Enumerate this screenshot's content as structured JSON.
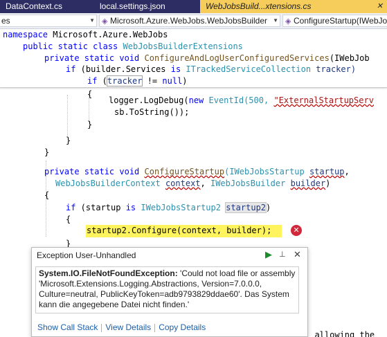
{
  "tabs": [
    {
      "label": "DataContext.cs",
      "close": ""
    },
    {
      "label": "local.settings.json",
      "close": ""
    },
    {
      "label": "WebJobsBuild...xtensions.cs",
      "close": "✕"
    }
  ],
  "navbar": {
    "project": "es",
    "type": "Microsoft.Azure.WebJobs.WebJobsBuilder",
    "member": "ConfigureStartup(IWebJo"
  },
  "code": {
    "l1_kw": "namespace",
    "l1_text": " Microsoft.Azure.WebJobs",
    "l2_kw": "public static class",
    "l2_type": "WebJobsBuilderExtensions",
    "l3_kw": "private static void",
    "l3_name": "ConfigureAndLogUserConfiguredServices",
    "l3_rest": "(IWebJob",
    "l4_kw": "if",
    "l4_a": " (builder.Services ",
    "l4_is": "is",
    "l4_type": "ITrackedServiceCollection",
    "l4_var": " tracker)",
    "l5_kw": "if",
    "l5_a": " (",
    "l5_var": "tracker",
    "l5_b": " != ",
    "l5_null": "null",
    "l5_c": ")",
    "l6": "{",
    "l7_a": "logger.LogDebug(",
    "l7_new": "new",
    "l7_b": " EventId(500, ",
    "l7_str": "\"ExternalStartupServ",
    "l8": "sb.ToString());",
    "l9": "}",
    "l10": "}",
    "l11": "}",
    "l12_kw": "private static void",
    "l12_name": "ConfigureStartup",
    "l12_type": "(IWebJobsStartup",
    "l12_var": "startup",
    "l13_type": "WebJobsBuilderContext",
    "l13_var": "context",
    "l13_type2": "IWebJobsBuilder",
    "l13_var2": "builder",
    "l14": "{",
    "l15_kw": "if",
    "l15_a": " (startup ",
    "l15_is": "is",
    "l15_type": "IWebJobsStartup2",
    "l15_var": "startup2",
    "l16": "{",
    "l17": "startup2.Configure(context, builder);",
    "l18": "}",
    "l19_tail": ", allowing the"
  },
  "exception": {
    "title": "Exception User-Unhandled",
    "type": "System.IO.FileNotFoundException:",
    "message": " 'Could not load file or assembly 'Microsoft.Extensions.Logging.Abstractions, Version=7.0.0.0, Culture=neutral, PublicKeyToken=adb9793829ddae60'. Das System kann die angegebene Datei nicht finden.'",
    "links": {
      "call_stack": "Show Call Stack",
      "view_details": "View Details",
      "copy_details": "Copy Details"
    },
    "play_icon": "▶",
    "pin_icon": "📌",
    "close_icon": "✕",
    "error_glyph": "✕"
  }
}
